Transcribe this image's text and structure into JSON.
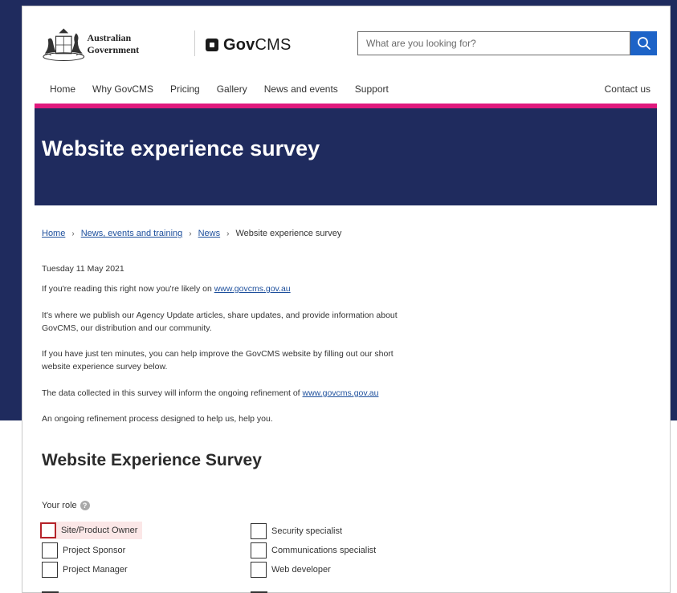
{
  "header": {
    "gov_name": "Australian Government",
    "brand_bold": "Gov",
    "brand_rest": "CMS",
    "search_placeholder": "What are you looking for?"
  },
  "nav": {
    "items": [
      "Home",
      "Why GovCMS",
      "Pricing",
      "Gallery",
      "News and events",
      "Support"
    ],
    "contact": "Contact us"
  },
  "hero": {
    "title": "Website experience survey"
  },
  "breadcrumb": {
    "home": "Home",
    "news_events": "News, events and training",
    "news": "News",
    "current": "Website experience survey",
    "separator": "›"
  },
  "article": {
    "date": "Tuesday 11 May 2021",
    "p1_text": "If you're reading this right now you're likely on ",
    "p1_link": "www.govcms.gov.au",
    "p2": "It's where we publish our Agency Update articles, share updates, and provide information about GovCMS, our distribution and our community.",
    "p3": "If you have just ten minutes, you can help improve the GovCMS website by filling out our short website experience survey below.",
    "p4_text": "The data collected in this survey will inform the ongoing refinement of ",
    "p4_link": "www.govcms.gov.au",
    "p5": "An ongoing refinement process designed to help us, help you."
  },
  "survey": {
    "title": "Website Experience Survey",
    "role_label": "Your role",
    "help_glyph": "?",
    "options_left": [
      "Site/Product Owner",
      "Project Sponsor",
      "Project Manager"
    ],
    "options_right": [
      "Security specialist",
      "Communications specialist",
      "Web developer"
    ]
  },
  "colors": {
    "navy": "#1f2b5e",
    "pink_accent": "#e0197d",
    "search_blue": "#1d63c7",
    "link_blue": "#1d4f9c",
    "focus_red": "#b5232a"
  },
  "icons": {
    "crest": "coat-of-arms-icon",
    "brand": "govcms-logo-icon",
    "search": "search-icon",
    "help": "help-icon"
  }
}
